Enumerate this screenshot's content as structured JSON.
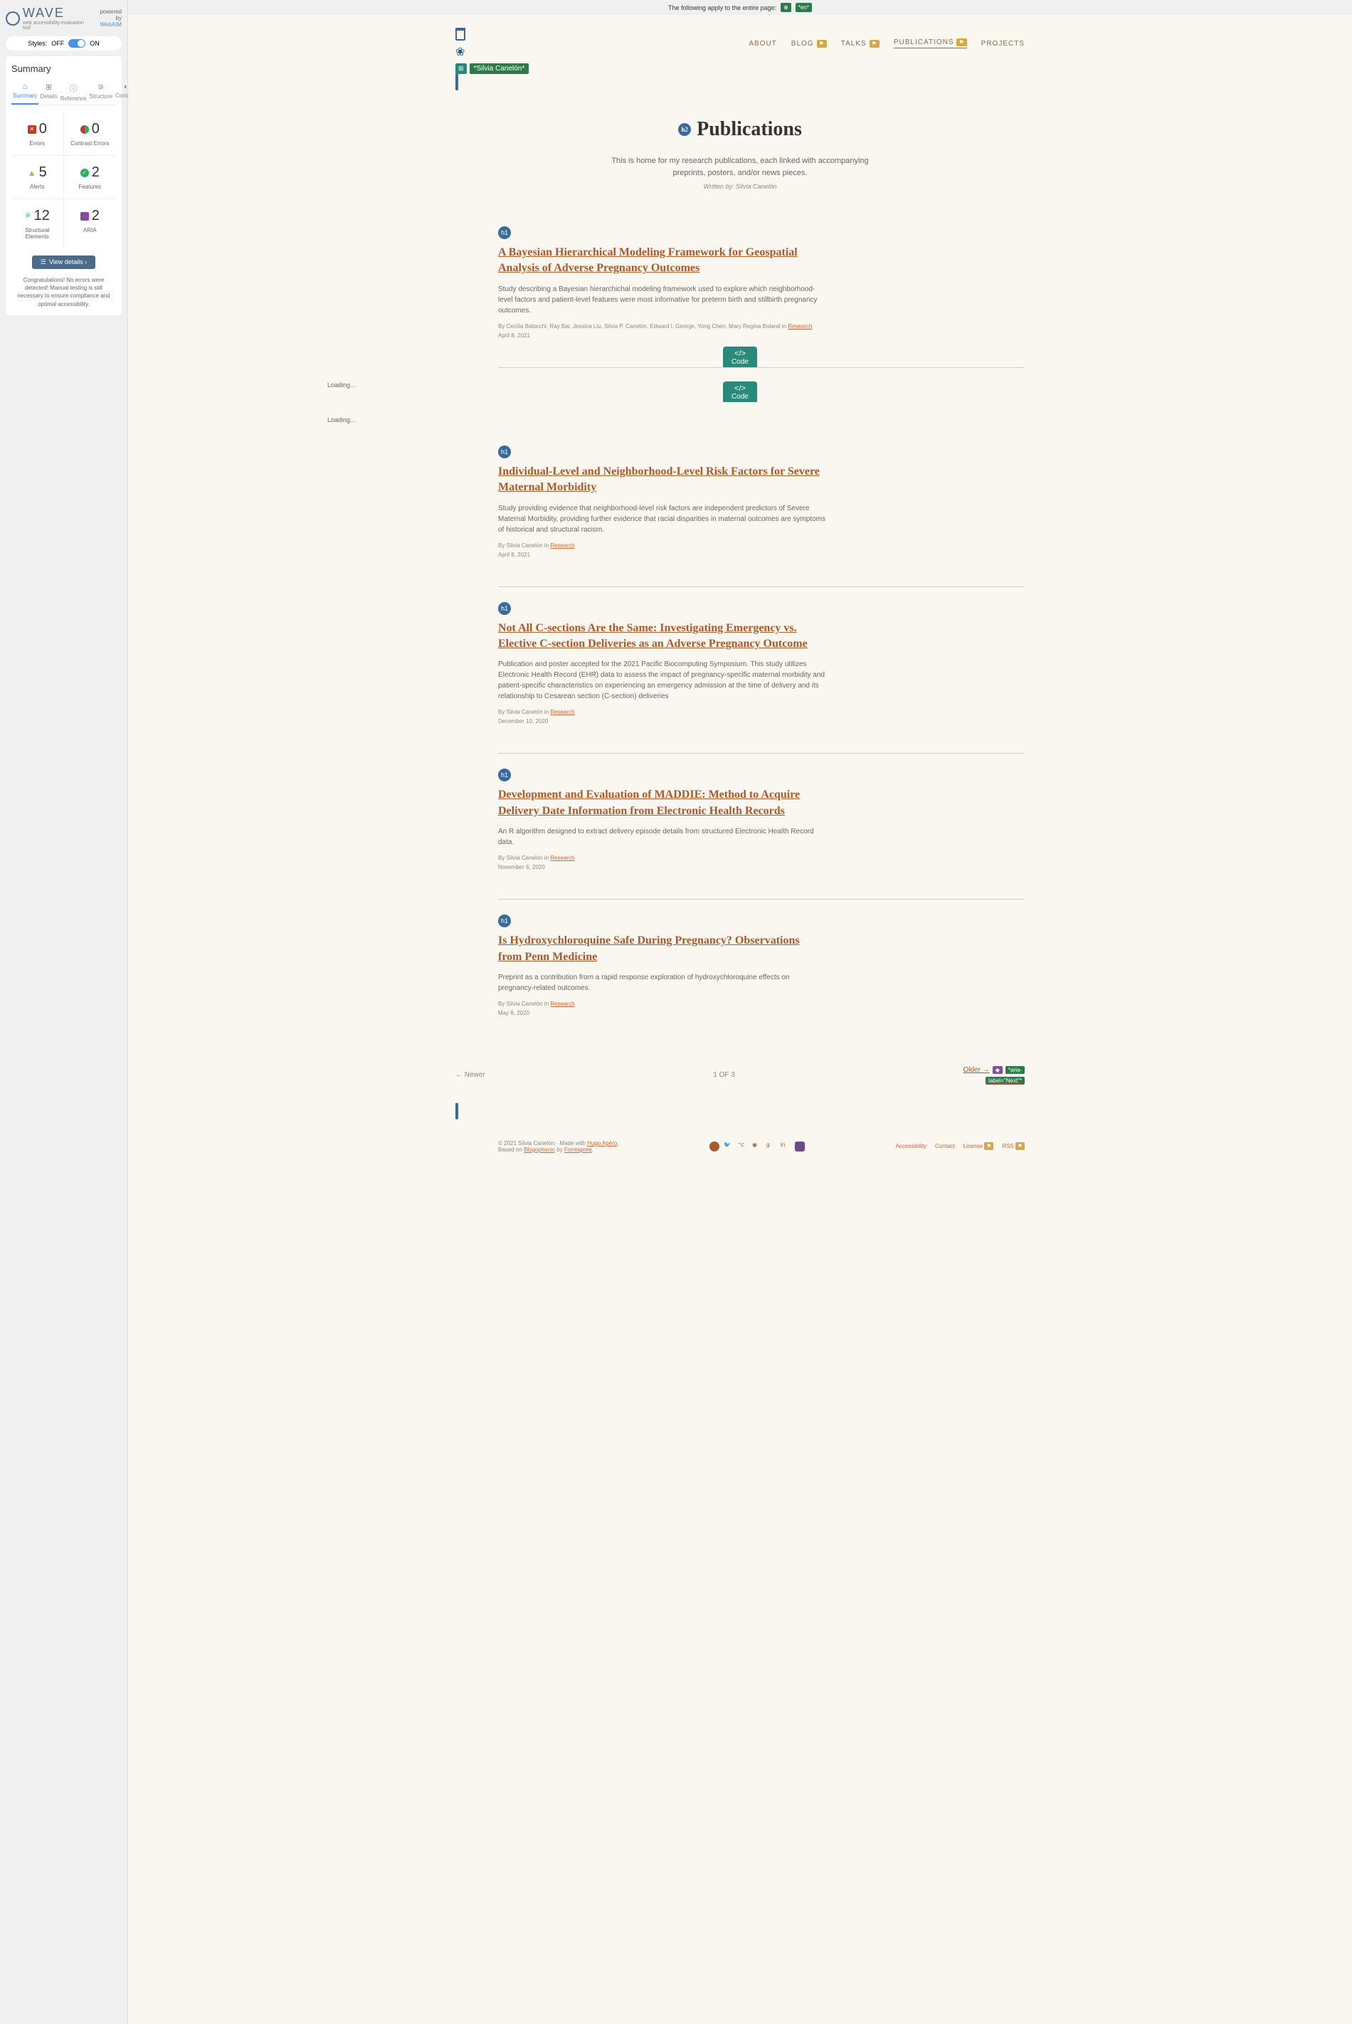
{
  "sidebar": {
    "logo_text": "WAVE",
    "logo_sub": "web accessibility evaluation tool",
    "powered_label": "powered by",
    "powered_link": "WebAIM",
    "styles_label": "Styles:",
    "styles_off": "OFF",
    "styles_on": "ON",
    "summary_title": "Summary",
    "tabs": [
      {
        "label": "Summary",
        "icon": "⌂"
      },
      {
        "label": "Details",
        "icon": "⊞"
      },
      {
        "label": "Reference",
        "icon": "ⓘ"
      },
      {
        "label": "Structure",
        "icon": "⚞"
      },
      {
        "label": "Contrast",
        "icon": "◐"
      }
    ],
    "stats": [
      {
        "count": "0",
        "label": "Errors",
        "icon": "err"
      },
      {
        "count": "0",
        "label": "Contrast Errors",
        "icon": "contrast"
      },
      {
        "count": "5",
        "label": "Alerts",
        "icon": "alert"
      },
      {
        "count": "2",
        "label": "Features",
        "icon": "feat"
      },
      {
        "count": "12",
        "label": "Structural Elements",
        "icon": "struct"
      },
      {
        "count": "2",
        "label": "ARIA",
        "icon": "aria"
      }
    ],
    "view_details": "View details ›",
    "congrats": "Congratulations! No errors were detected! Manual testing is still necessary to ensure compliance and optimal accessibility."
  },
  "topbar": {
    "text": "The following apply to the entire page:",
    "badge1": "⊕",
    "badge2": "*en*"
  },
  "header": {
    "name_badge": "*Silvia Canelón*",
    "nav": [
      {
        "label": "ABOUT",
        "badge": false
      },
      {
        "label": "BLOG",
        "badge": true
      },
      {
        "label": "TALKS",
        "badge": true
      },
      {
        "label": "PUBLICATIONS",
        "badge": true,
        "active": true
      },
      {
        "label": "PROJECTS",
        "badge": false
      }
    ]
  },
  "page": {
    "h2_badge": "h2",
    "title": "Publications",
    "desc": "This is home for my research publications, each linked with accompanying preprints, posters, and/or news pieces.",
    "written_by": "Written by: Silvia Canelón",
    "code_label": "Code",
    "loading": "Loading..."
  },
  "pubs": [
    {
      "h1": "h1",
      "title": "A Bayesian Hierarchical Modeling Framework for Geospatial Analysis of Adverse Pregnancy Outcomes",
      "desc": "Study describing a Bayesian hierarchichal modeling framework used to explore which neighborhood-level factors and patient-level features were most informative for preterm birth and stillbirth pregnancy outcomes.",
      "meta_prefix": "By Cecilia Balocchi, Ray Bai, Jessica Liu, Silvia P. Canelón, Edward I. George, Yong Chen, Mary Regina Boland in ",
      "meta_link": "Research",
      "date": "April 8, 2021"
    },
    {
      "h1": "h1",
      "title": "Individual-Level and Neighborhood-Level Risk Factors for Severe Maternal Morbidity",
      "desc": "Study providing evidence that neighborhood-level risk factors are independent predictors of Severe Maternal Morbidity, providing further evidence that racial disparities in maternal outcomes are symptoms of historical and structural racism.",
      "meta_prefix": "By Silvia Canelón in ",
      "meta_link": "Research",
      "date": "April 8, 2021"
    },
    {
      "h1": "h1",
      "title": "Not All C-sections Are the Same: Investigating Emergency vs. Elective C-section Deliveries as an Adverse Pregnancy Outcome",
      "desc": "Publication and poster accepted for the 2021 Pacific Biocomputing Symposium. This study utilizes Electronic Health Record (EHR) data to assess the impact of pregnancy-specific maternal morbidity and patient-specific characteristics on experiencing an emergency admission at the time of delivery and its relationship to Cesarean section (C-section) deliveries",
      "meta_prefix": "By Silvia Canelón in ",
      "meta_link": "Research",
      "date": "December 10, 2020"
    },
    {
      "h1": "h1",
      "title": "Development and Evaluation of MADDIE: Method to Acquire Delivery Date Information from Electronic Health Records",
      "desc": "An R algorithm designed to extract delivery episode details from structured Electronic Health Record data.",
      "meta_prefix": "By Silvia Canelón in ",
      "meta_link": "Research",
      "date": "November 6, 2020"
    },
    {
      "h1": "h1",
      "title": "Is Hydroxychloroquine Safe During Pregnancy? Observations from Penn Medicine",
      "desc": "Preprint as a contribution from a rapid response exploration of hydroxychloroquine effects on pregnancy-related outcomes.",
      "meta_prefix": "By Silvia Canelón in ",
      "meta_link": "Research",
      "date": "May 8, 2020"
    }
  ],
  "pagination": {
    "newer": "← Newer",
    "center": "1 OF 3",
    "older": "Older →",
    "aria1": "*aria-",
    "aria2": "label=\"Next\"*"
  },
  "footer": {
    "copyright": "© 2021 Silvia Canelón",
    "made_sep": " · Made with ",
    "made_link": "Hugo Apéro",
    "based": "Based on ",
    "based_link": "Blogophonic",
    "by": " by ",
    "by_link": "Formspree",
    "links": [
      {
        "label": "Accessibility"
      },
      {
        "label": "Contact"
      },
      {
        "label": "License",
        "badge": true
      },
      {
        "label": "RSS",
        "badge": true
      }
    ]
  }
}
